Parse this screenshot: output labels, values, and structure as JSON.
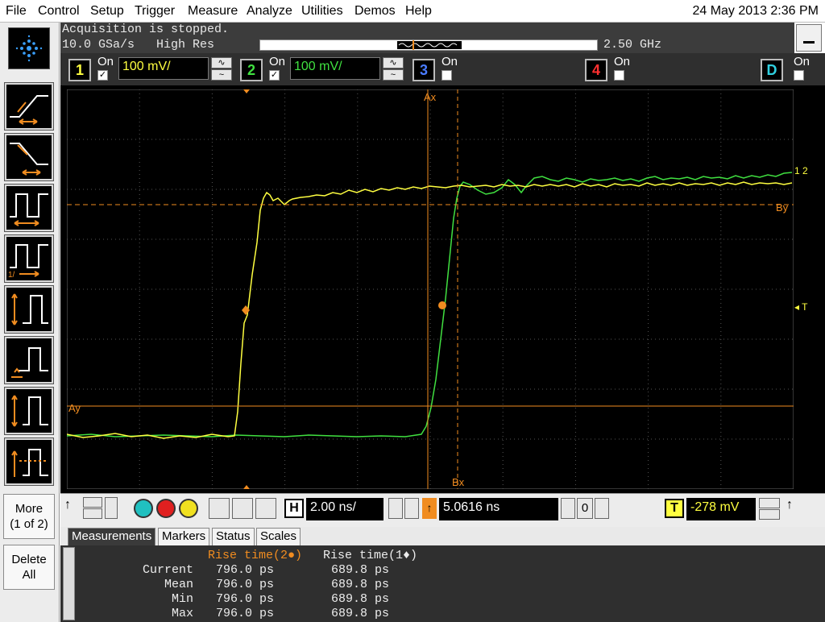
{
  "menu": [
    "File",
    "Control",
    "Setup",
    "Trigger",
    "Measure",
    "Analyze",
    "Utilities",
    "Demos",
    "Help"
  ],
  "datetime": "24 May 2013  2:36 PM",
  "acquisition": {
    "status": "Acquisition is stopped.",
    "sample_rate_mode": "10.0 GSa/s   High Res",
    "bandwidth": "2.50 GHz"
  },
  "channels": [
    {
      "number": "1",
      "on_label": "On",
      "enabled": true,
      "scale": "100 mV/",
      "color": "#ffff40"
    },
    {
      "number": "2",
      "on_label": "On",
      "enabled": true,
      "scale": "100 mV/",
      "color": "#40e040"
    },
    {
      "number": "3",
      "on_label": "On",
      "enabled": false,
      "color": "#4a7cff"
    },
    {
      "number": "4",
      "on_label": "On",
      "enabled": false,
      "color": "#ff3030"
    },
    {
      "number": "D",
      "on_label": "On",
      "enabled": false,
      "color": "#30d0e0"
    }
  ],
  "left_toolbar": {
    "buttons": [
      "rise-time-icon",
      "fall-time-icon",
      "period-icon",
      "frequency-icon",
      "vpp-icon",
      "vbase-icon",
      "vtop-icon",
      "vamp-icon"
    ],
    "more_label": "More\n(1 of 2)",
    "delete_label": "Delete\nAll"
  },
  "scope": {
    "markers": {
      "ax": "Ax",
      "bx": "Bx",
      "ay": "Ay",
      "by": "By",
      "trigger": "T",
      "ch12": "1 2"
    }
  },
  "horizontal": {
    "h_label": "H",
    "timebase": "2.00 ns/",
    "delay": "5.0616 ns",
    "zero_label": "0",
    "trigger_label": "T",
    "trigger_level": "-278 mV"
  },
  "tabs": [
    "Measurements",
    "Markers",
    "Status",
    "Scales"
  ],
  "measurements": {
    "header_rise2": "Rise time(2●)",
    "header_rise1": "Rise time(1♦)",
    "rows": [
      {
        "label": "Current",
        "v2": "796.0 ps",
        "v1": "689.8 ps"
      },
      {
        "label": "Mean",
        "v2": "796.0 ps",
        "v1": "689.8 ps"
      },
      {
        "label": "Min",
        "v2": "796.0 ps",
        "v1": "689.8 ps"
      },
      {
        "label": "Max",
        "v2": "796.0 ps",
        "v1": "689.8 ps"
      }
    ]
  },
  "colors": {
    "marker_orange": "#f08c20",
    "ch1_yellow": "#ffff40",
    "ch2_green": "#40e040"
  }
}
